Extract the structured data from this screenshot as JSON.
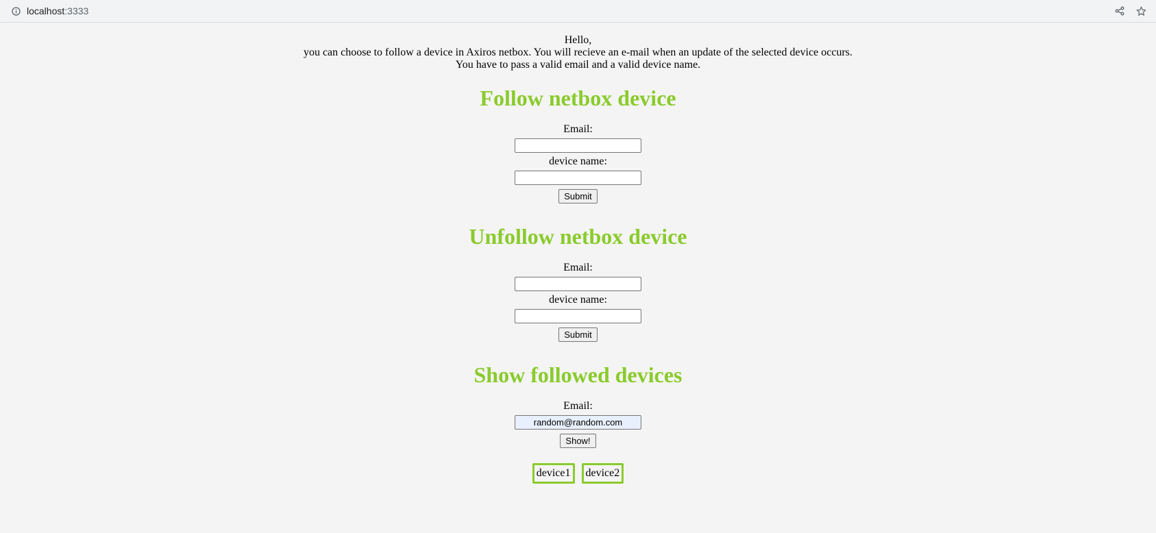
{
  "browser": {
    "host": "localhost",
    "port": ":3333",
    "icons": [
      "info-icon",
      "share-icon",
      "star-icon"
    ]
  },
  "intro": {
    "line1": "Hello,",
    "line2": "you can choose to follow a device in Axiros netbox. You will recieve an e-mail when an update of the selected device occurs.",
    "line3": "You have to pass a valid email and a valid device name."
  },
  "follow": {
    "title": "Follow netbox device",
    "email_label": "Email:",
    "email_value": "",
    "device_label": "device name:",
    "device_value": "",
    "submit_label": "Submit"
  },
  "unfollow": {
    "title": "Unfollow netbox device",
    "email_label": "Email:",
    "email_value": "",
    "device_label": "device name:",
    "device_value": "",
    "submit_label": "Submit"
  },
  "show": {
    "title": "Show followed devices",
    "email_label": "Email:",
    "email_value": "random@random.com",
    "button_label": "Show!"
  },
  "devices": [
    "device1",
    "device2"
  ],
  "colors": {
    "heading": "#8acb2c",
    "device_border": "#8acb2c",
    "background": "#f4f4f4"
  }
}
